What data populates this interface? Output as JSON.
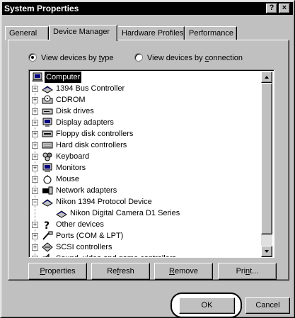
{
  "window": {
    "title": "System Properties",
    "help_label": "?",
    "close_label": "×"
  },
  "tabs": [
    {
      "label": "General"
    },
    {
      "label": "Device Manager"
    },
    {
      "label": "Hardware Profiles"
    },
    {
      "label": "Performance"
    }
  ],
  "view_options": {
    "by_type": {
      "pre": "View devices by ",
      "hot": "t",
      "post": "ype",
      "selected": true
    },
    "by_connection": {
      "pre": "View devices by ",
      "hot": "c",
      "post": "onnection",
      "selected": false
    }
  },
  "tree": {
    "root": "Computer",
    "items": [
      {
        "label": "1394 Bus Controller",
        "icon": "bus-controller-icon",
        "expander": "+"
      },
      {
        "label": "CDROM",
        "icon": "cdrom-icon",
        "expander": "+"
      },
      {
        "label": "Disk drives",
        "icon": "disk-drive-icon",
        "expander": "+"
      },
      {
        "label": "Display adapters",
        "icon": "display-adapter-icon",
        "expander": "+"
      },
      {
        "label": "Floppy disk controllers",
        "icon": "floppy-controller-icon",
        "expander": "+"
      },
      {
        "label": "Hard disk controllers",
        "icon": "hard-disk-controller-icon",
        "expander": "+"
      },
      {
        "label": "Keyboard",
        "icon": "keyboard-icon",
        "expander": "+"
      },
      {
        "label": "Monitors",
        "icon": "monitor-icon",
        "expander": "+"
      },
      {
        "label": "Mouse",
        "icon": "mouse-icon",
        "expander": "+"
      },
      {
        "label": "Network adapters",
        "icon": "network-adapter-icon",
        "expander": "+"
      },
      {
        "label": "Nikon 1394 Protocol Device",
        "icon": "protocol-device-icon",
        "expander": "−"
      },
      {
        "label": "Nikon Digital Camera D1 Series",
        "icon": "camera-device-icon",
        "expander": ""
      },
      {
        "label": "Other devices",
        "icon": "question-mark-icon",
        "expander": "+"
      },
      {
        "label": "Ports (COM & LPT)",
        "icon": "port-icon",
        "expander": "+"
      },
      {
        "label": "SCSI controllers",
        "icon": "scsi-icon",
        "expander": "+"
      },
      {
        "label": "Sound, video and game controllers",
        "icon": "sound-icon",
        "expander": "+"
      }
    ]
  },
  "buttons": {
    "properties": {
      "pre": "",
      "hot": "P",
      "post": "roperties"
    },
    "refresh": {
      "pre": "Re",
      "hot": "f",
      "post": "resh"
    },
    "remove": {
      "pre": "",
      "hot": "R",
      "post": "emove"
    },
    "print": {
      "pre": "Pri",
      "hot": "n",
      "post": "t..."
    },
    "ok": "OK",
    "cancel": "Cancel"
  },
  "colors": {
    "face": "#c0c0c0",
    "titlebar": "#000000",
    "selection": "#000000"
  }
}
